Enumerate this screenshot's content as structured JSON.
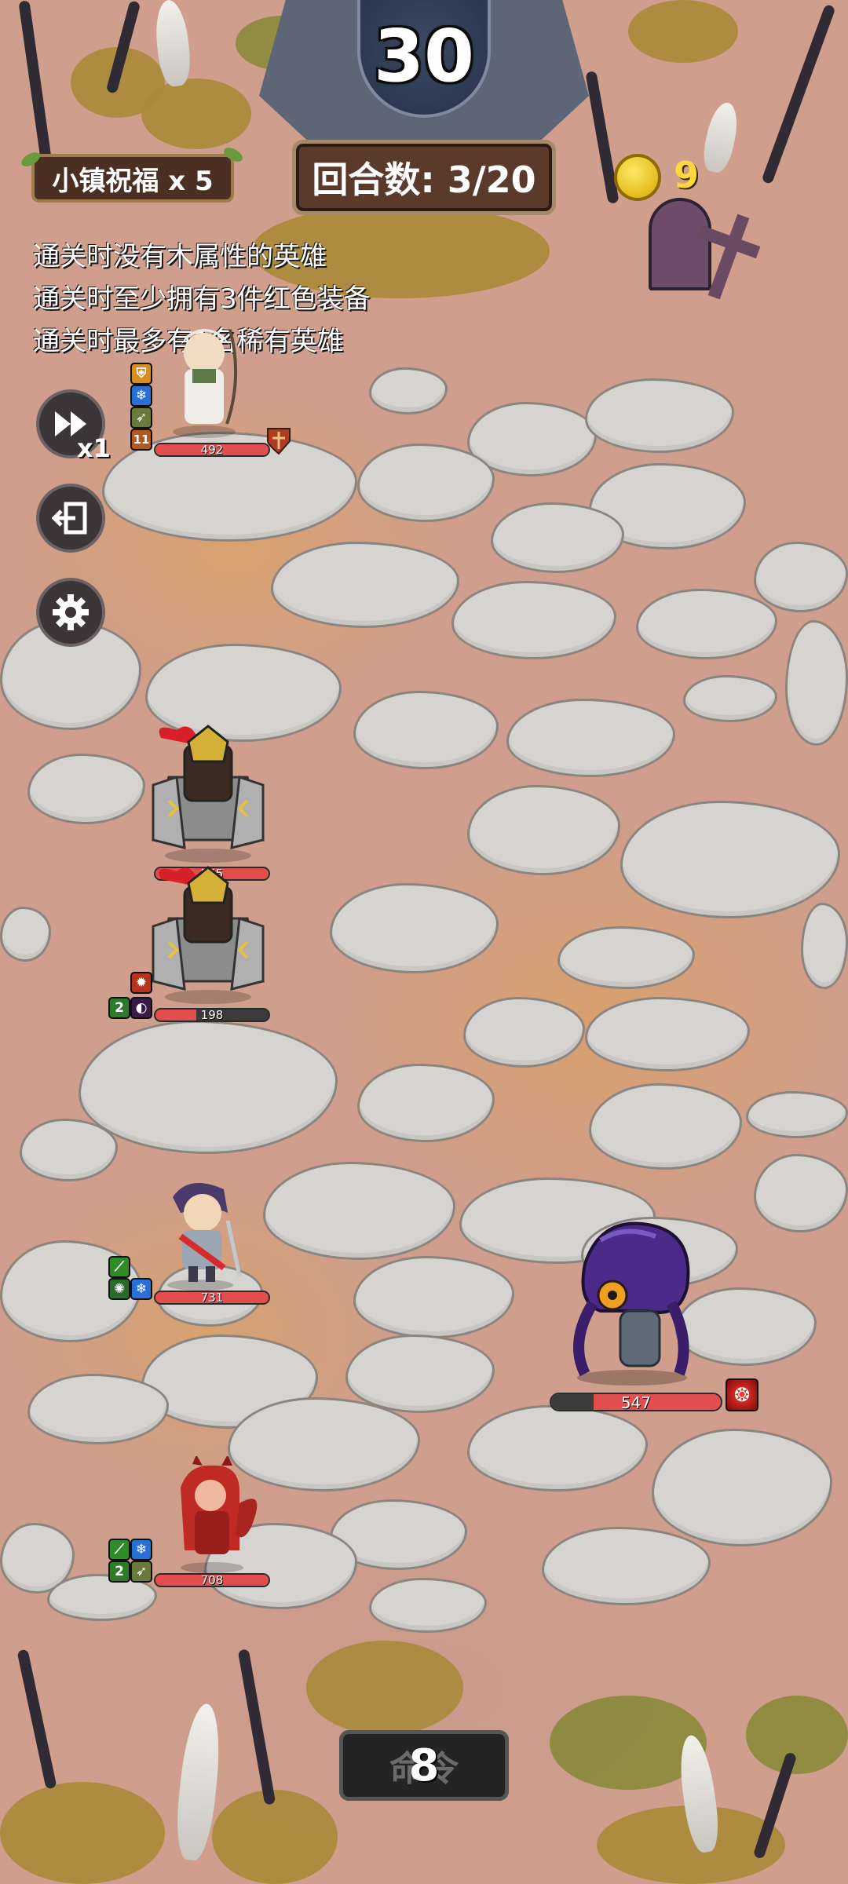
{
  "timer": {
    "value": "30"
  },
  "blessing": {
    "label": "小镇祝福 x 5"
  },
  "round": {
    "label": "回合数: 3/20"
  },
  "currency": {
    "icon": "gold-coin-icon",
    "value": "9"
  },
  "objectives": [
    "通关时没有木属性的英雄",
    "通关时至少拥有3件红色装备",
    "通关时最多有1名稀有英雄"
  ],
  "controls": {
    "speed": {
      "icon": "fast-forward-icon",
      "label": "x1"
    },
    "exit": {
      "icon": "exit-icon"
    },
    "settings": {
      "icon": "gear-icon"
    }
  },
  "heroes": [
    {
      "name": "white-archer",
      "hp": "492",
      "hp_fraction": 1.0,
      "badge": "11",
      "buffs": [
        "shield",
        "ice",
        "bow"
      ]
    },
    {
      "name": "gold-knight-1",
      "hp": "545",
      "hp_fraction": 1.0,
      "badge": "",
      "buffs": []
    },
    {
      "name": "gold-knight-2",
      "hp": "198",
      "hp_fraction": 0.36,
      "badge": "2",
      "buffs": [
        "fire",
        "poison",
        "shadow"
      ]
    },
    {
      "name": "purple-swordsman",
      "hp": "731",
      "hp_fraction": 1.0,
      "badge": "",
      "buffs": [
        "wind",
        "poison",
        "ice"
      ]
    },
    {
      "name": "red-demon",
      "hp": "708",
      "hp_fraction": 1.0,
      "badge": "2",
      "buffs": [
        "wind",
        "ice",
        "bow"
      ]
    }
  ],
  "enemy": {
    "name": "purple-crab-monster",
    "hp": "547",
    "hp_fraction": 1.0
  },
  "command": {
    "bg_label": "命令",
    "value": "8"
  },
  "colors": {
    "hp": "#e24d4d",
    "coin": "#ffd93a",
    "ground": "#d9a270",
    "stone": "#d6d4d0"
  }
}
